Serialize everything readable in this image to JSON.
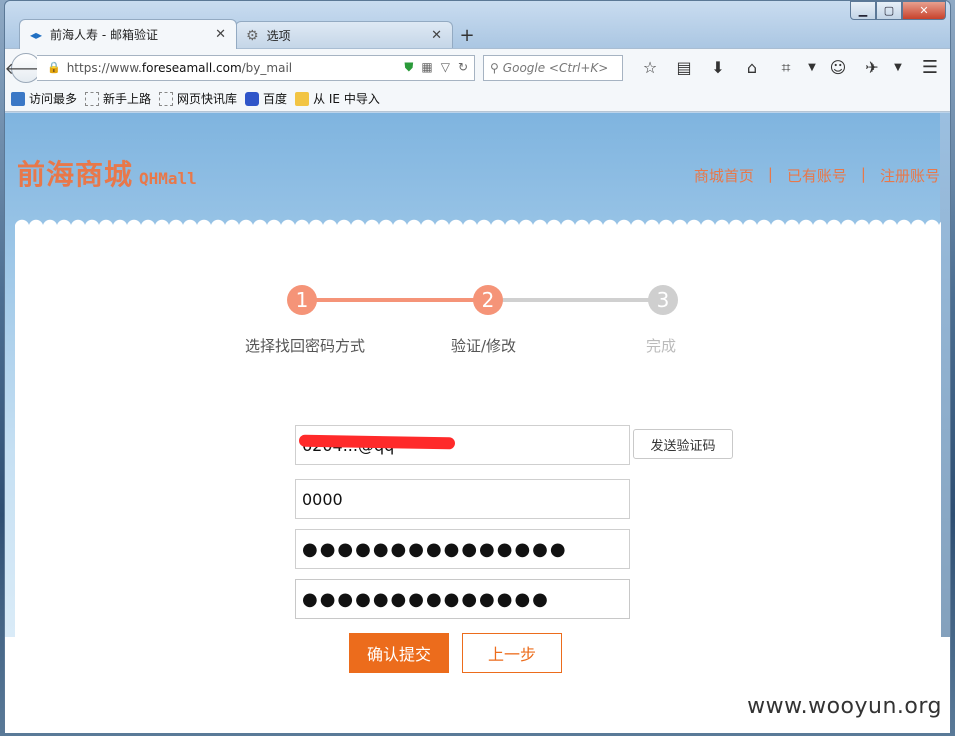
{
  "browser": {
    "tabs": [
      {
        "title": "前海人寿 - 邮箱验证",
        "icon": "arrow-icon",
        "active": true
      },
      {
        "title": "选项",
        "icon": "gear-icon",
        "active": false
      }
    ],
    "new_tab": "+",
    "url_scheme": "https://www.",
    "url_host": "foreseamall.com",
    "url_path": "/by_mail",
    "search_placeholder": "Google <Ctrl+K>",
    "bookmarks": [
      {
        "label": "访问最多",
        "icon": "blue"
      },
      {
        "label": "新手上路",
        "icon": "dashed"
      },
      {
        "label": "网页快讯库",
        "icon": "dashed"
      },
      {
        "label": "百度",
        "icon": "paw"
      },
      {
        "label": "从 IE 中导入",
        "icon": "folder"
      }
    ]
  },
  "site": {
    "logo_main": "前海商城",
    "logo_sub": "QHMall",
    "nav": [
      "商城首页",
      "已有账号",
      "注册账号"
    ],
    "nav_sep": "|"
  },
  "steps": [
    {
      "num": "1",
      "label": "选择找回密码方式"
    },
    {
      "num": "2",
      "label": "验证/修改"
    },
    {
      "num": "3",
      "label": "完成"
    }
  ],
  "form": {
    "email_value": "6204...@qq",
    "code_value": "0000",
    "password_value": "●●●●●●●●●●●●●●●",
    "confirm_value": "●●●●●●●●●●●●●●",
    "send_code_label": "发送验证码",
    "submit_label": "确认提交",
    "prev_label": "上一步"
  },
  "watermark": "www.wooyun.org"
}
